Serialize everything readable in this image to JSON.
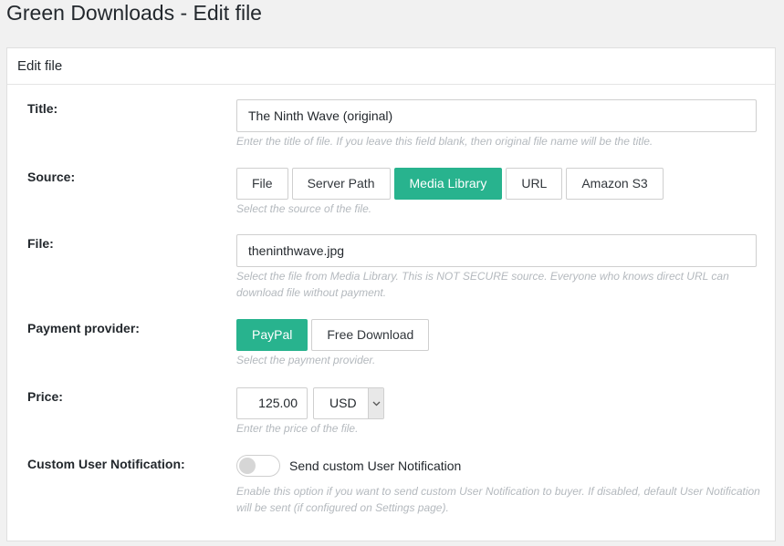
{
  "page": {
    "title": "Green Downloads - Edit file"
  },
  "panel": {
    "title": "Edit file"
  },
  "form": {
    "title": {
      "label": "Title:",
      "value": "The Ninth Wave (original)",
      "help": "Enter the title of file. If you leave this field blank, then original file name will be the title."
    },
    "source": {
      "label": "Source:",
      "options": [
        "File",
        "Server Path",
        "Media Library",
        "URL",
        "Amazon S3"
      ],
      "selected": "Media Library",
      "help": "Select the source of the file."
    },
    "file": {
      "label": "File:",
      "value": "theninthwave.jpg",
      "help": "Select the file from Media Library. This is NOT SECURE source. Everyone who knows direct URL can download file without payment."
    },
    "payment_provider": {
      "label": "Payment provider:",
      "options": [
        "PayPal",
        "Free Download"
      ],
      "selected": "PayPal",
      "help": "Select the payment provider."
    },
    "price": {
      "label": "Price:",
      "amount": "125.00",
      "currency": "USD",
      "help": "Enter the price of the file."
    },
    "notification": {
      "label": "Custom User Notification:",
      "toggle_label": "Send custom User Notification",
      "enabled": false,
      "help": "Enable this option if you want to send custom User Notification to buyer. If disabled, default User Notification will be sent (if configured on Settings page)."
    }
  },
  "colors": {
    "accent": "#28b38e",
    "help_text": "#b4b9be",
    "page_bg": "#f1f1f1"
  },
  "icons": {
    "currency_caret": "chevron-down-icon"
  }
}
